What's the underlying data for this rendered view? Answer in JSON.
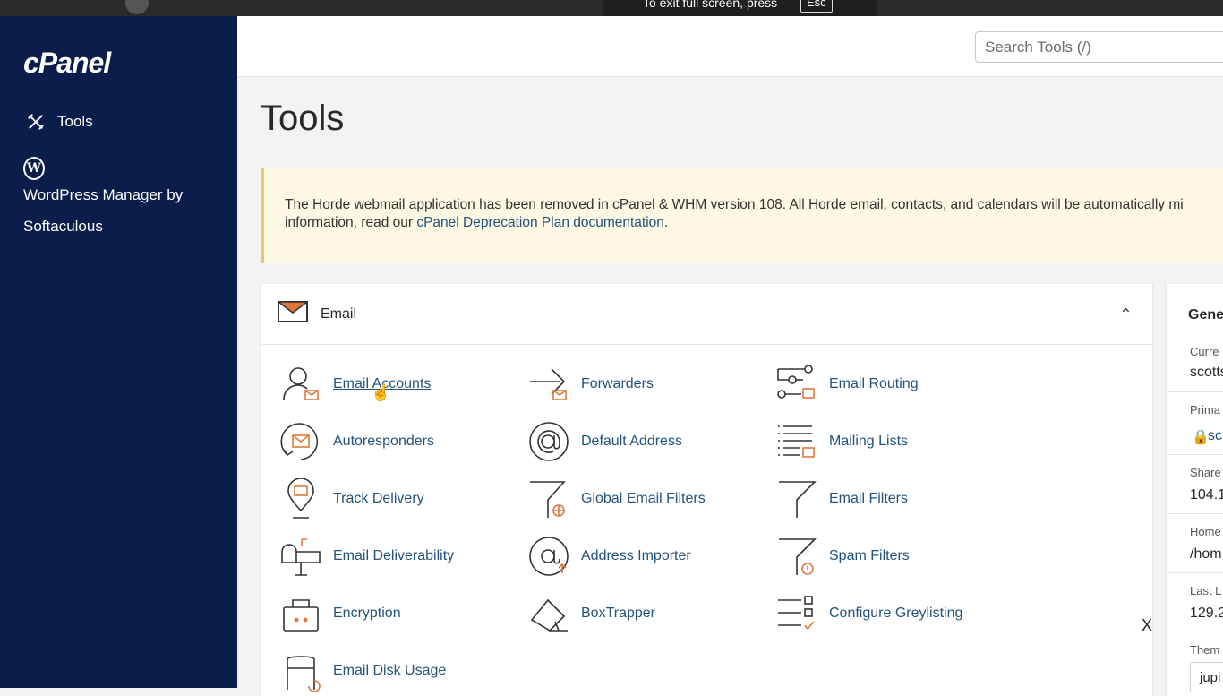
{
  "toast": {
    "text": "To exit full screen, press",
    "key": "Esc"
  },
  "sidebar": {
    "logo": "cPanel",
    "items": [
      {
        "label": "Tools",
        "icon": "tools-icon"
      },
      {
        "label": "WordPress Manager by Softaculous",
        "icon": "wordpress-icon"
      }
    ]
  },
  "header": {
    "search_placeholder": "Search Tools (/)"
  },
  "page": {
    "title": "Tools"
  },
  "notice": {
    "text_line1": "The Horde webmail application has been removed in cPanel & WHM version 108. All Horde email, contacts, and calendars will be automatically mi",
    "text_line2_prefix": "information, read our ",
    "link": "cPanel Deprecation Plan documentation",
    "text_line2_suffix": "."
  },
  "email_panel": {
    "title": "Email",
    "items": [
      {
        "label": "Email Accounts",
        "icon": "email-accounts-icon"
      },
      {
        "label": "Forwarders",
        "icon": "forwarders-icon"
      },
      {
        "label": "Email Routing",
        "icon": "email-routing-icon"
      },
      {
        "label": "Autoresponders",
        "icon": "autoresponders-icon"
      },
      {
        "label": "Default Address",
        "icon": "default-address-icon"
      },
      {
        "label": "Mailing Lists",
        "icon": "mailing-lists-icon"
      },
      {
        "label": "Track Delivery",
        "icon": "track-delivery-icon"
      },
      {
        "label": "Global Email Filters",
        "icon": "global-email-filters-icon"
      },
      {
        "label": "Email Filters",
        "icon": "email-filters-icon"
      },
      {
        "label": "Email Deliverability",
        "icon": "email-deliverability-icon"
      },
      {
        "label": "Address Importer",
        "icon": "address-importer-icon"
      },
      {
        "label": "Spam Filters",
        "icon": "spam-filters-icon"
      },
      {
        "label": "Encryption",
        "icon": "encryption-icon"
      },
      {
        "label": "BoxTrapper",
        "icon": "boxtrapper-icon"
      },
      {
        "label": "Configure Greylisting",
        "icon": "greylisting-icon"
      },
      {
        "label": "Email Disk Usage",
        "icon": "disk-usage-icon"
      }
    ]
  },
  "general_panel": {
    "title": "Gene",
    "rows": [
      {
        "label": "Curre",
        "value": "scotts"
      },
      {
        "label": "Prima",
        "value": "sc"
      },
      {
        "label": "Share",
        "value": "104.1"
      },
      {
        "label": "Home",
        "value": "/hom"
      },
      {
        "label": "Last L",
        "value": "129.2"
      },
      {
        "label": "Them",
        "value": "jupi"
      }
    ]
  },
  "close_mark": "X",
  "colors": {
    "sidebar": "#0b1d4b",
    "link": "#23527c",
    "accent": "#e0783e",
    "notice_bg": "#fcf8e3"
  }
}
